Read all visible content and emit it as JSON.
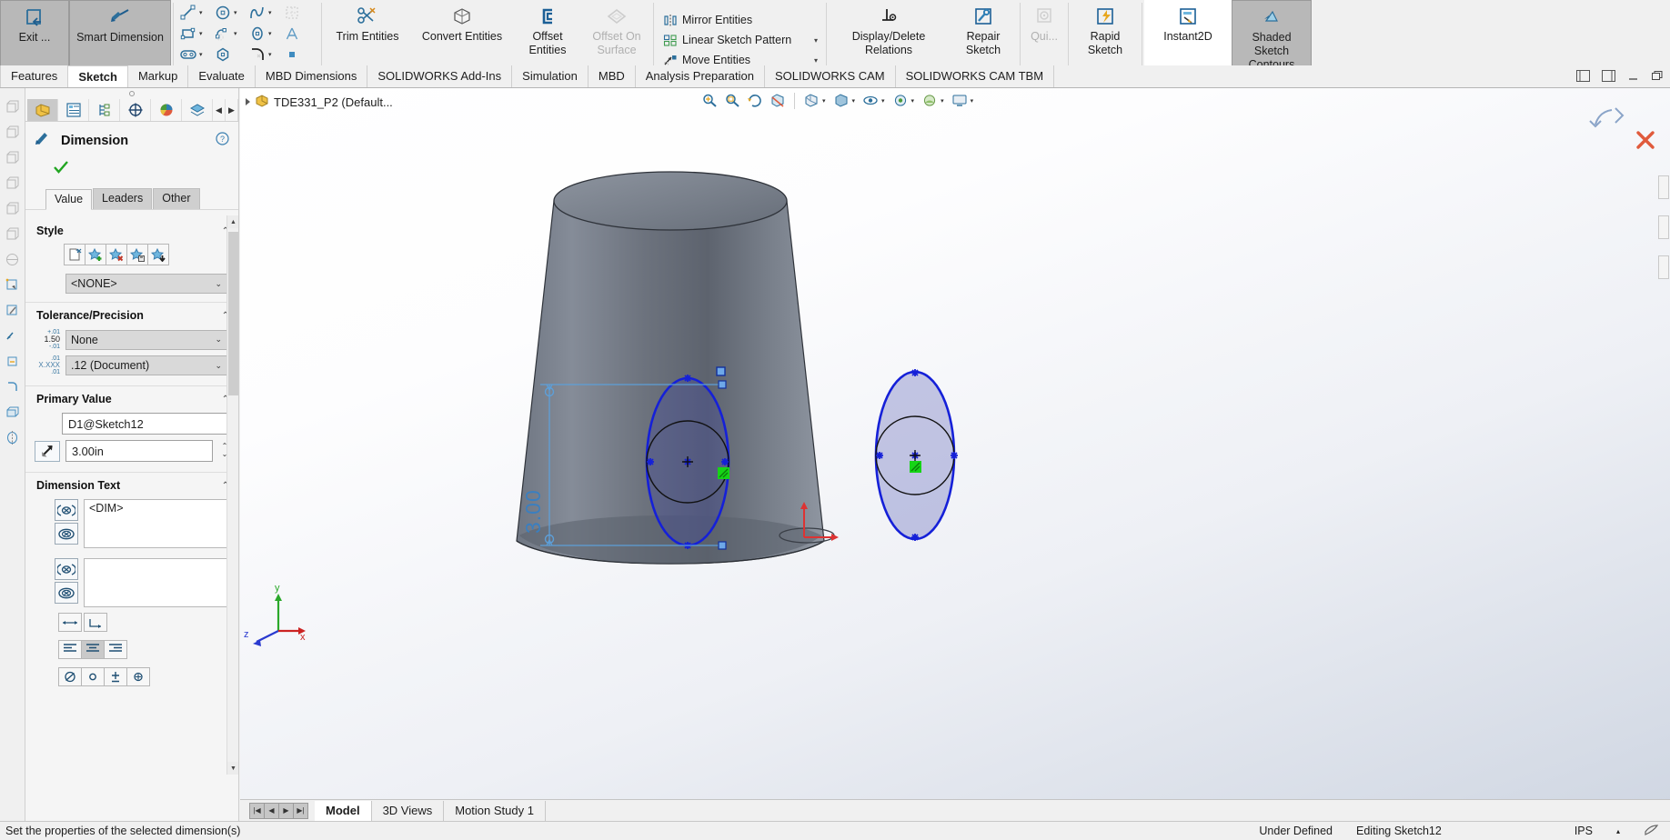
{
  "app": {
    "document_title": "TDE331_P2  (Default...",
    "status_message": "Set the properties of the selected dimension(s)",
    "status_state": "Under Defined",
    "status_editing": "Editing Sketch12",
    "status_units": "IPS"
  },
  "ribbon": {
    "groups": [
      {
        "name": "sketch-exit",
        "buttons": [
          {
            "label": "Exit ...",
            "icon": "exit-sketch-icon",
            "state": "normal",
            "caret": true
          },
          {
            "label": "Smart Dimension",
            "icon": "smart-dimension-icon",
            "state": "active",
            "caret": true
          }
        ]
      },
      {
        "name": "sketch-entities-grid",
        "tools": [
          {
            "icon": "line-icon",
            "caret": true
          },
          {
            "icon": "circle-icon",
            "caret": true
          },
          {
            "icon": "spline-icon",
            "caret": true
          },
          {
            "icon": "grid-snap-icon",
            "caret": false
          },
          {
            "icon": "rectangle-icon",
            "caret": true
          },
          {
            "icon": "slot-icon",
            "caret": true
          },
          {
            "icon": "ellipse-icon",
            "caret": true
          },
          {
            "icon": "text-icon",
            "caret": false
          },
          {
            "icon": "straight-slot-icon",
            "caret": true
          },
          {
            "icon": "polygon-icon",
            "caret": false
          },
          {
            "icon": "fillet-icon",
            "caret": true
          },
          {
            "icon": "point-icon",
            "caret": false
          }
        ]
      },
      {
        "name": "sketch-modify",
        "buttons": [
          {
            "label": "Trim Entities",
            "icon": "trim-entities-icon",
            "state": "normal",
            "caret": true
          },
          {
            "label": "Convert Entities",
            "icon": "convert-entities-icon",
            "state": "normal",
            "caret": true
          },
          {
            "label": "Offset Entities",
            "icon": "offset-entities-icon",
            "state": "normal",
            "caret": false
          },
          {
            "label": "Offset On Surface",
            "icon": "offset-on-surface-icon",
            "state": "disabled",
            "caret": false
          }
        ]
      },
      {
        "name": "sketch-pattern",
        "rows": [
          {
            "label": "Mirror Entities",
            "icon": "mirror-entities-icon",
            "caret": false
          },
          {
            "label": "Linear Sketch Pattern",
            "icon": "linear-sketch-pattern-icon",
            "caret": true
          },
          {
            "label": "Move Entities",
            "icon": "move-entities-icon",
            "caret": true
          }
        ]
      },
      {
        "name": "sketch-relations",
        "buttons": [
          {
            "label": "Display/Delete Relations",
            "icon": "display-delete-relations-icon",
            "state": "normal",
            "caret": true
          },
          {
            "label": "Repair Sketch",
            "icon": "repair-sketch-icon",
            "state": "normal",
            "caret": false
          },
          {
            "label": "Qui...",
            "icon": "quick-snaps-icon",
            "state": "disabled",
            "caret": true
          },
          {
            "label": "Rapid Sketch",
            "icon": "rapid-sketch-icon",
            "state": "normal",
            "caret": false
          },
          {
            "label": "Instant2D",
            "icon": "instant2d-icon",
            "state": "normal",
            "caret": false
          },
          {
            "label": "Shaded Sketch Contours",
            "icon": "shaded-sketch-contours-icon",
            "state": "active",
            "caret": false
          }
        ]
      }
    ]
  },
  "command_tabs": [
    {
      "label": "Features",
      "selected": false
    },
    {
      "label": "Sketch",
      "selected": true
    },
    {
      "label": "Markup",
      "selected": false
    },
    {
      "label": "Evaluate",
      "selected": false
    },
    {
      "label": "MBD Dimensions",
      "selected": false
    },
    {
      "label": "SOLIDWORKS Add-Ins",
      "selected": false
    },
    {
      "label": "Simulation",
      "selected": false
    },
    {
      "label": "MBD",
      "selected": false
    },
    {
      "label": "Analysis Preparation",
      "selected": false
    },
    {
      "label": "SOLIDWORKS CAM",
      "selected": false
    },
    {
      "label": "SOLIDWORKS CAM TBM",
      "selected": false
    }
  ],
  "property_manager": {
    "tabs": [
      {
        "name": "feature-manager-tab",
        "icon": "feature-tree-icon",
        "selected": true
      },
      {
        "name": "property-manager-tab",
        "icon": "property-list-icon",
        "selected": false
      },
      {
        "name": "configuration-manager-tab",
        "icon": "configuration-icon",
        "selected": false
      },
      {
        "name": "dimxpert-manager-tab",
        "icon": "dimxpert-icon",
        "selected": false
      },
      {
        "name": "display-manager-tab",
        "icon": "display-palette-icon",
        "selected": false
      },
      {
        "name": "cam-feature-tab",
        "icon": "cam-layers-icon",
        "selected": false
      }
    ],
    "title": "Dimension",
    "title_icon": "dimension-icon",
    "help_icon": "help-icon",
    "ok_icon": "ok-check-icon",
    "value_tabs": [
      {
        "label": "Value",
        "selected": true
      },
      {
        "label": "Leaders",
        "selected": false
      },
      {
        "label": "Other",
        "selected": false
      }
    ],
    "sections": {
      "style": {
        "title": "Style",
        "buttons": [
          {
            "name": "no-style-button",
            "icon": "style-none-icon"
          },
          {
            "name": "add-style-button",
            "icon": "style-add-icon"
          },
          {
            "name": "delete-style-button",
            "icon": "style-delete-icon"
          },
          {
            "name": "save-style-button",
            "icon": "style-save-icon"
          },
          {
            "name": "load-style-button",
            "icon": "style-load-icon"
          }
        ],
        "style_value": "<NONE>"
      },
      "tolerance": {
        "title": "Tolerance/Precision",
        "tolerance_icon": "tolerance-type-icon",
        "tolerance_value": "None",
        "precision_icon": "precision-icon",
        "precision_value": ".12 (Document)"
      },
      "primary_value": {
        "title": "Primary Value",
        "name_value": "D1@Sketch12",
        "dimension_icon": "override-value-icon",
        "dimension_value": "3.00in"
      },
      "dimension_text": {
        "title": "Dimension Text",
        "text_value": "<DIM>",
        "second_value": "",
        "text_btn1": "add-parenthesis-icon",
        "text_btn2": "inspection-dim-icon",
        "text_btn3": "add-parenthesis-icon",
        "text_btn4": "inspection-dim-icon",
        "extra_btn1": "dual-dimension-icon",
        "extra_btn2": "offset-text-icon",
        "align_buttons": [
          {
            "name": "align-left-button",
            "icon": "align-left-icon",
            "selected": false
          },
          {
            "name": "align-center-button",
            "icon": "align-center-icon",
            "selected": true
          },
          {
            "name": "align-right-button",
            "icon": "align-right-icon",
            "selected": false
          }
        ],
        "symbol_buttons": [
          {
            "name": "symbol-diameter-button",
            "icon": "diameter-symbol-icon"
          },
          {
            "name": "symbol-degree-button",
            "icon": "degree-symbol-icon"
          },
          {
            "name": "symbol-plusminus-button",
            "icon": "plus-minus-symbol-icon"
          },
          {
            "name": "symbol-more-button",
            "icon": "more-symbols-icon"
          }
        ]
      }
    }
  },
  "viewport": {
    "tree_root": "TDE331_P2  (Default...",
    "toolbar_icons": [
      {
        "name": "zoom-to-fit-icon",
        "caret": false
      },
      {
        "name": "zoom-to-area-icon",
        "caret": false
      },
      {
        "name": "previous-view-icon",
        "caret": false
      },
      {
        "name": "section-view-icon",
        "caret": false
      },
      {
        "name": "view-orientation-icon",
        "caret": true
      },
      {
        "name": "display-style-icon",
        "caret": true
      },
      {
        "name": "hide-show-items-icon",
        "caret": true
      },
      {
        "name": "edit-appearance-icon",
        "caret": true
      },
      {
        "name": "apply-scene-icon",
        "caret": true
      },
      {
        "name": "view-settings-icon",
        "caret": true
      }
    ],
    "dimension_label": "3.00",
    "triad": {
      "x": "x",
      "y": "y",
      "z": "z"
    },
    "bottom_tabs": [
      {
        "label": "Model",
        "selected": true
      },
      {
        "label": "3D Views",
        "selected": false
      },
      {
        "label": "Motion Study 1",
        "selected": false
      }
    ]
  },
  "colors": {
    "accent_blue": "#0b2fd8",
    "sketch_blue": "#4f8fd0",
    "model_gray_light": "#9ba0ab",
    "model_gray_dark": "#4c515c",
    "selection_green": "#12c312",
    "ribbon_bg": "#f0f0f0",
    "active_tab_bg": "#b8b8b8"
  }
}
